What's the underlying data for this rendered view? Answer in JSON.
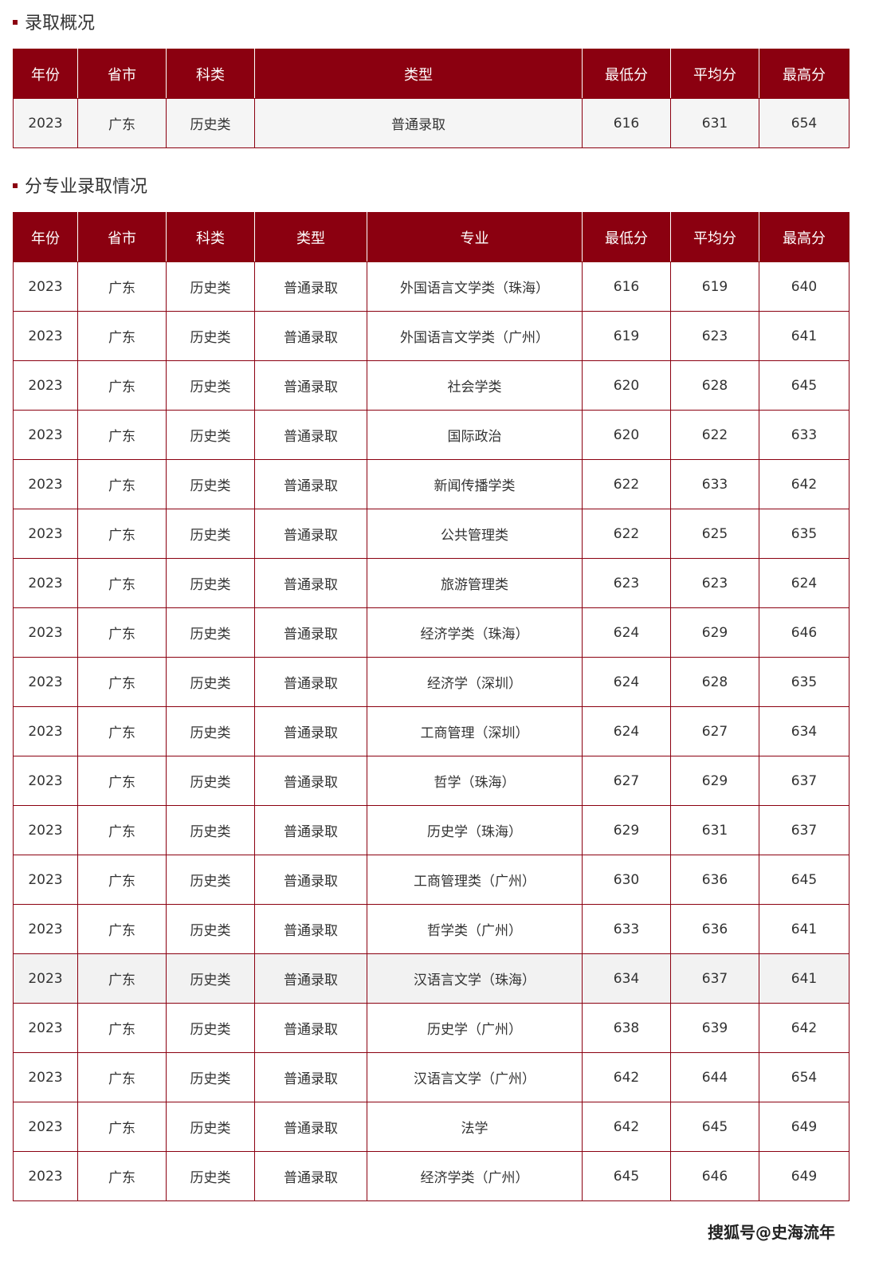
{
  "colors": {
    "accent": "#8b0010",
    "header_text": "#ffffff",
    "row_alt": "#f2f2f2"
  },
  "summary": {
    "title": "录取概况",
    "columns": [
      "年份",
      "省市",
      "科类",
      "类型",
      "最低分",
      "平均分",
      "最高分"
    ],
    "rows": [
      [
        "2023",
        "广东",
        "历史类",
        "普通录取",
        "616",
        "631",
        "654"
      ]
    ]
  },
  "majors": {
    "title": "分专业录取情况",
    "columns": [
      "年份",
      "省市",
      "科类",
      "类型",
      "专业",
      "最低分",
      "平均分",
      "最高分"
    ],
    "rows": [
      [
        "2023",
        "广东",
        "历史类",
        "普通录取",
        "外国语言文学类（珠海）",
        "616",
        "619",
        "640"
      ],
      [
        "2023",
        "广东",
        "历史类",
        "普通录取",
        "外国语言文学类（广州）",
        "619",
        "623",
        "641"
      ],
      [
        "2023",
        "广东",
        "历史类",
        "普通录取",
        "社会学类",
        "620",
        "628",
        "645"
      ],
      [
        "2023",
        "广东",
        "历史类",
        "普通录取",
        "国际政治",
        "620",
        "622",
        "633"
      ],
      [
        "2023",
        "广东",
        "历史类",
        "普通录取",
        "新闻传播学类",
        "622",
        "633",
        "642"
      ],
      [
        "2023",
        "广东",
        "历史类",
        "普通录取",
        "公共管理类",
        "622",
        "625",
        "635"
      ],
      [
        "2023",
        "广东",
        "历史类",
        "普通录取",
        "旅游管理类",
        "623",
        "623",
        "624"
      ],
      [
        "2023",
        "广东",
        "历史类",
        "普通录取",
        "经济学类（珠海）",
        "624",
        "629",
        "646"
      ],
      [
        "2023",
        "广东",
        "历史类",
        "普通录取",
        "经济学（深圳）",
        "624",
        "628",
        "635"
      ],
      [
        "2023",
        "广东",
        "历史类",
        "普通录取",
        "工商管理（深圳）",
        "624",
        "627",
        "634"
      ],
      [
        "2023",
        "广东",
        "历史类",
        "普通录取",
        "哲学（珠海）",
        "627",
        "629",
        "637"
      ],
      [
        "2023",
        "广东",
        "历史类",
        "普通录取",
        "历史学（珠海）",
        "629",
        "631",
        "637"
      ],
      [
        "2023",
        "广东",
        "历史类",
        "普通录取",
        "工商管理类（广州）",
        "630",
        "636",
        "645"
      ],
      [
        "2023",
        "广东",
        "历史类",
        "普通录取",
        "哲学类（广州）",
        "633",
        "636",
        "641"
      ],
      [
        "2023",
        "广东",
        "历史类",
        "普通录取",
        "汉语言文学（珠海）",
        "634",
        "637",
        "641"
      ],
      [
        "2023",
        "广东",
        "历史类",
        "普通录取",
        "历史学（广州）",
        "638",
        "639",
        "642"
      ],
      [
        "2023",
        "广东",
        "历史类",
        "普通录取",
        "汉语言文学（广州）",
        "642",
        "644",
        "654"
      ],
      [
        "2023",
        "广东",
        "历史类",
        "普通录取",
        "法学",
        "642",
        "645",
        "649"
      ],
      [
        "2023",
        "广东",
        "历史类",
        "普通录取",
        "经济学类（广州）",
        "645",
        "646",
        "649"
      ]
    ],
    "highlighted_row": 14
  },
  "watermark": "搜狐号@史海流年"
}
